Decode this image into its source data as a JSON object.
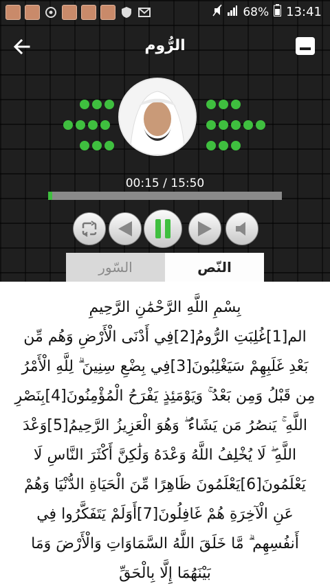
{
  "status_bar": {
    "battery": "68%",
    "time": "13:41",
    "left_icons": [
      "photo-thumbnail-icon",
      "photo-thumbnail-icon",
      "sync-icon",
      "photo-thumbnail-icon",
      "photo-thumbnail-icon",
      "photo-thumbnail-icon",
      "shield-icon",
      "mail-icon"
    ],
    "right_icons": [
      "mute-icon",
      "signal-icon",
      "battery-icon"
    ]
  },
  "toolbar": {
    "title": "الرُّوم",
    "back_icon": "arrow-back-icon",
    "menu_icon": "menu-icon"
  },
  "player": {
    "time_display": "00:15 / 15:50",
    "progress": 0.016,
    "accent": "#3fbf3f",
    "controls": [
      "repeat-icon",
      "previous-icon",
      "pause-icon",
      "next-icon",
      "volume-icon"
    ]
  },
  "tabs": [
    {
      "label": "السّور",
      "active": false
    },
    {
      "label": "النّص",
      "active": true
    }
  ],
  "surah_text": "بِسْمِ اللَّهِ الرَّحْمَٰنِ الرَّحِيمِ\nالم[1]غُلِبَتِ الرُّومُ[2]فِي أَدْنَى الْأَرْضِ وَهُم مِّن بَعْدِ غَلَبِهِمْ سَيَغْلِبُونَ[3]فِي بِضْعِ سِنِينَ ۗ لِلَّهِ الْأَمْرُ مِن قَبْلُ وَمِن بَعْدُ ۚ وَيَوْمَئِذٍ يَفْرَحُ الْمُؤْمِنُونَ[4]بِنَصْرِ اللَّهِ ۚ يَنصُرُ مَن يَشَاءُ ۖ وَهُوَ الْعَزِيزُ الرَّحِيمُ[5]وَعْدَ اللَّهِ ۖ لَا يُخْلِفُ اللَّهُ وَعْدَهُ وَلَٰكِنَّ أَكْثَرَ النَّاسِ لَا يَعْلَمُونَ[6]يَعْلَمُونَ ظَاهِرًا مِّنَ الْحَيَاةِ الدُّنْيَا وَهُمْ عَنِ الْآخِرَةِ هُمْ غَافِلُونَ[7]أَوَلَمْ يَتَفَكَّرُوا فِي أَنفُسِهِم ۗ مَّا خَلَقَ اللَّهُ السَّمَاوَاتِ وَالْأَرْضَ وَمَا بَيْنَهُمَا إِلَّا بِالْحَقِّ"
}
